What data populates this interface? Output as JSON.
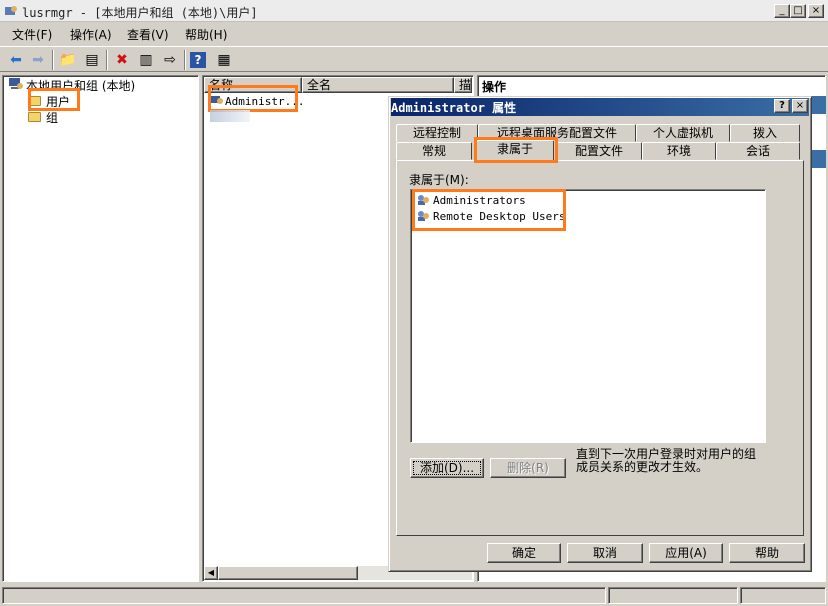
{
  "window": {
    "title": "lusrmgr - [本地用户和组 (本地)\\用户]",
    "min": "_",
    "max": "□",
    "close": "×"
  },
  "menu": [
    "文件(F)",
    "操作(A)",
    "查看(V)",
    "帮助(H)"
  ],
  "tree": {
    "root": "本地用户和组 (本地)",
    "children": [
      "用户",
      "组"
    ]
  },
  "list": {
    "columns": [
      "名称",
      "全名",
      "描"
    ],
    "rows": [
      "Administr..."
    ]
  },
  "actions_header": "操作",
  "dialog": {
    "title": "Administrator 属性",
    "help": "?",
    "close": "×",
    "tabs_row1": [
      "远程控制",
      "远程桌面服务配置文件",
      "个人虚拟机",
      "拨入"
    ],
    "tabs_row2": [
      "常规",
      "隶属于",
      "配置文件",
      "环境",
      "会话"
    ],
    "member_label": "隶属于(M):",
    "groups": [
      "Administrators",
      "Remote Desktop Users"
    ],
    "add_button": "添加(D)...",
    "remove_button": "删除(R)",
    "note": "直到下一次用户登录时对用户的组成员关系的更改才生效。",
    "ok": "确定",
    "cancel": "取消",
    "apply": "应用(A)",
    "help_button": "帮助"
  },
  "colors": {
    "highlight": "#ff7a1a",
    "title_active": "#0a246a"
  }
}
